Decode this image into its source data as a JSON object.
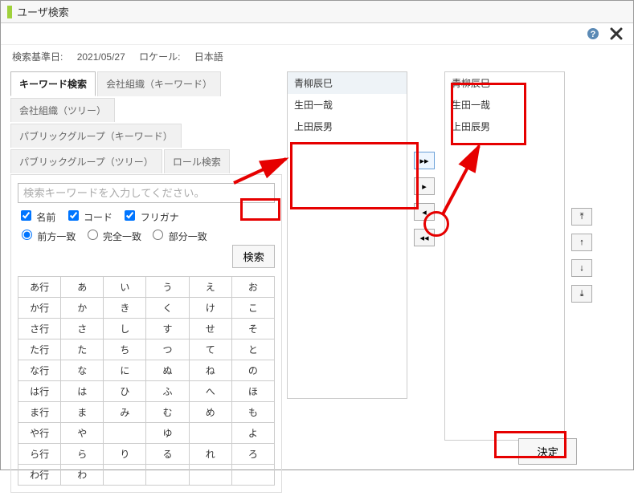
{
  "window": {
    "title": "ユーザ検索"
  },
  "meta": {
    "date_label": "検索基準日:",
    "date_value": "2021/05/27",
    "locale_label": "ロケール:",
    "locale_value": "日本語"
  },
  "tabs": {
    "keyword": "キーワード検索",
    "company_kw": "会社組織（キーワード）",
    "company_tree": "会社組織（ツリー）",
    "public_kw": "パブリックグループ（キーワード）",
    "public_tree": "パブリックグループ（ツリー）",
    "role": "ロール検索"
  },
  "search": {
    "placeholder": "検索キーワードを入力してください。",
    "value": "",
    "chk_name": "名前",
    "chk_code": "コード",
    "chk_kana": "フリガナ",
    "r_prefix": "前方一致",
    "r_full": "完全一致",
    "r_partial": "部分一致",
    "button": "検索"
  },
  "kana": {
    "rows": [
      [
        "あ行",
        "あ",
        "い",
        "う",
        "え",
        "お"
      ],
      [
        "か行",
        "か",
        "き",
        "く",
        "け",
        "こ"
      ],
      [
        "さ行",
        "さ",
        "し",
        "す",
        "せ",
        "そ"
      ],
      [
        "た行",
        "た",
        "ち",
        "つ",
        "て",
        "と"
      ],
      [
        "な行",
        "な",
        "に",
        "ぬ",
        "ね",
        "の"
      ],
      [
        "は行",
        "は",
        "ひ",
        "ふ",
        "へ",
        "ほ"
      ],
      [
        "ま行",
        "ま",
        "み",
        "む",
        "め",
        "も"
      ],
      [
        "や行",
        "や",
        "",
        "ゆ",
        "",
        "よ"
      ],
      [
        "ら行",
        "ら",
        "り",
        "る",
        "れ",
        "ろ"
      ],
      [
        "わ行",
        "わ",
        "",
        "",
        "",
        ""
      ]
    ]
  },
  "results": {
    "items": [
      "青柳辰巳",
      "生田一哉",
      "上田辰男"
    ]
  },
  "selected": {
    "items": [
      "青柳辰巳",
      "生田一哉",
      "上田辰男"
    ]
  },
  "move": {
    "all_right": "▸▸",
    "one_right": "▸",
    "one_left": "◂",
    "all_left": "◂◂"
  },
  "sort": {
    "top": "⤒",
    "up": "↑",
    "down": "↓",
    "bottom": "⤓"
  },
  "footer": {
    "decide": "決定"
  }
}
